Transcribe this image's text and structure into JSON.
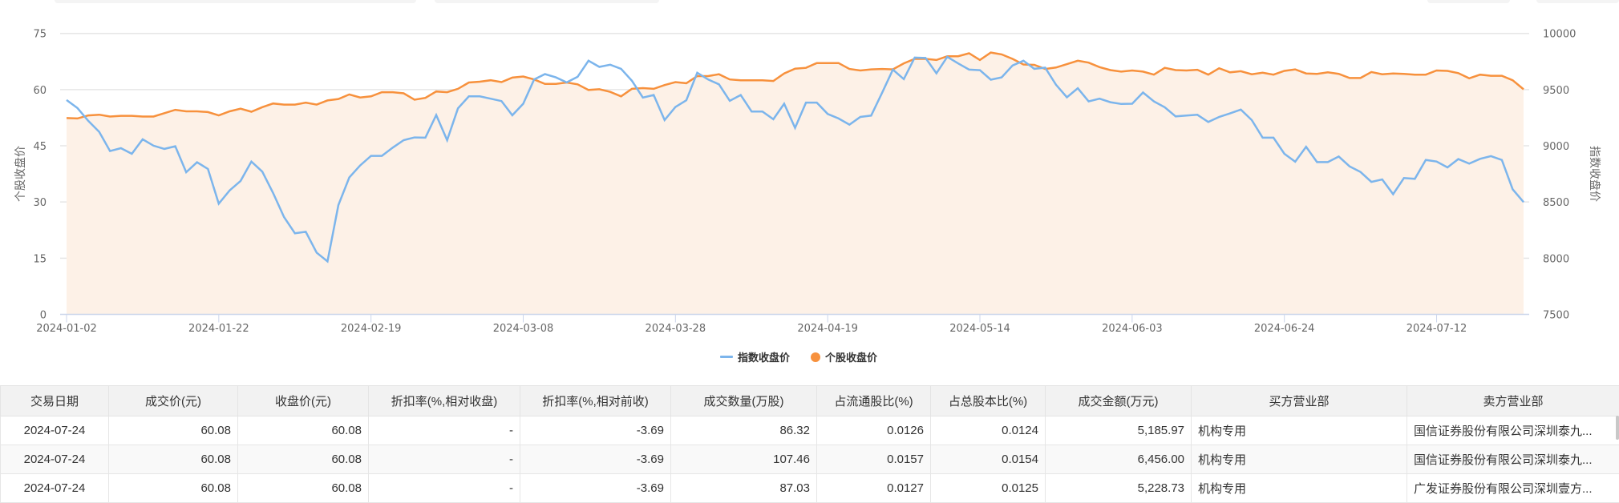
{
  "colors": {
    "index": "#7cb5ec",
    "stock": "#f7913d",
    "fill": "#fdf1e7",
    "grid": "#e6e6e6",
    "axis": "#ccd6eb"
  },
  "chart_data": {
    "type": "line",
    "title": "",
    "left_axis": {
      "label": "个股收盘价",
      "ylim": [
        0,
        75
      ],
      "ticks": [
        "0",
        "15",
        "30",
        "45",
        "60",
        "75"
      ]
    },
    "right_axis": {
      "label": "指数收盘价",
      "ylim": [
        7500,
        10000
      ],
      "ticks": [
        "7500",
        "8000",
        "8500",
        "9000",
        "9500",
        "10000"
      ]
    },
    "x_tick_labels": [
      {
        "index": 0,
        "label": "2024-01-02"
      },
      {
        "index": 14,
        "label": "2024-01-22"
      },
      {
        "index": 28,
        "label": "2024-02-19"
      },
      {
        "index": 42,
        "label": "2024-03-08"
      },
      {
        "index": 56,
        "label": "2024-03-28"
      },
      {
        "index": 70,
        "label": "2024-04-19"
      },
      {
        "index": 84,
        "label": "2024-05-14"
      },
      {
        "index": 98,
        "label": "2024-06-03"
      },
      {
        "index": 112,
        "label": "2024-06-24"
      },
      {
        "index": 126,
        "label": "2024-07-12"
      }
    ],
    "point_count": 135,
    "grid": true,
    "legend_position": "bottom-center",
    "series": [
      {
        "name": "指数收盘价",
        "axis": "right",
        "type": "line",
        "values": [
          9407,
          9336,
          9222,
          9124,
          8953,
          8979,
          8929,
          9058,
          9001,
          8972,
          8996,
          8765,
          8853,
          8794,
          8485,
          8603,
          8687,
          8860,
          8770,
          8580,
          8366,
          8221,
          8235,
          8049,
          7971,
          8473,
          8718,
          8825,
          8910,
          8910,
          8984,
          9050,
          9074,
          9072,
          9274,
          9050,
          9333,
          9440,
          9440,
          9419,
          9398,
          9272,
          9374,
          9590,
          9638,
          9609,
          9564,
          9614,
          9757,
          9702,
          9721,
          9685,
          9578,
          9429,
          9452,
          9229,
          9345,
          9405,
          9650,
          9590,
          9547,
          9400,
          9452,
          9305,
          9305,
          9236,
          9374,
          9160,
          9384,
          9384,
          9283,
          9243,
          9188,
          9257,
          9269,
          9471,
          9678,
          9593,
          9785,
          9781,
          9645,
          9792,
          9733,
          9678,
          9673,
          9588,
          9609,
          9714,
          9757,
          9685,
          9695,
          9543,
          9431,
          9512,
          9395,
          9419,
          9388,
          9372,
          9374,
          9474,
          9395,
          9343,
          9262,
          9269,
          9276,
          9212,
          9257,
          9288,
          9322,
          9229,
          9072,
          9072,
          8929,
          8858,
          8991,
          8855,
          8855,
          8905,
          8817,
          8767,
          8679,
          8701,
          8570,
          8713,
          8706,
          8874,
          8860,
          8808,
          8882,
          8841,
          8884,
          8908,
          8874,
          8613,
          8499
        ]
      },
      {
        "name": "个股收盘价",
        "axis": "left",
        "type": "area",
        "values": [
          52.4,
          52.3,
          53.1,
          53.3,
          52.8,
          53.0,
          53.0,
          52.8,
          52.8,
          53.7,
          54.6,
          54.2,
          54.2,
          54.0,
          53.1,
          54.2,
          54.9,
          54.1,
          55.3,
          56.3,
          56.0,
          56.0,
          56.5,
          56.0,
          57.1,
          57.5,
          58.7,
          57.9,
          58.2,
          59.3,
          59.3,
          59.0,
          57.3,
          57.8,
          59.5,
          59.3,
          60.2,
          61.9,
          62.1,
          62.5,
          62.0,
          63.2,
          63.5,
          62.7,
          61.5,
          61.5,
          61.9,
          61.4,
          59.9,
          60.1,
          59.4,
          58.2,
          60.2,
          60.4,
          60.2,
          61.2,
          62.0,
          61.7,
          63.6,
          63.6,
          64.1,
          62.7,
          62.5,
          62.5,
          62.5,
          62.3,
          64.3,
          65.6,
          65.8,
          67.1,
          67.1,
          67.1,
          65.5,
          65.1,
          65.4,
          65.5,
          65.4,
          67.0,
          68.2,
          68.2,
          67.9,
          68.9,
          68.9,
          69.7,
          67.9,
          69.9,
          69.4,
          68.2,
          66.7,
          66.6,
          65.5,
          65.9,
          66.8,
          67.7,
          67.2,
          66.0,
          65.2,
          64.8,
          65.1,
          64.8,
          64.0,
          65.8,
          65.2,
          65.1,
          65.3,
          64.0,
          65.7,
          64.6,
          64.9,
          64.1,
          64.5,
          64.0,
          65.0,
          65.4,
          64.3,
          64.2,
          64.6,
          64.2,
          63.1,
          63.1,
          64.7,
          64.1,
          64.3,
          64.2,
          64.0,
          64.0,
          65.1,
          65.0,
          64.4,
          63.0,
          64.0,
          63.7,
          63.7,
          62.5,
          60.08
        ]
      }
    ]
  },
  "legend": {
    "index_label": "指数收盘价",
    "stock_label": "个股收盘价"
  },
  "table": {
    "headers": [
      "交易日期",
      "成交价(元)",
      "收盘价(元)",
      "折扣率(%,相对收盘)",
      "折扣率(%,相对前收)",
      "成交数量(万股)",
      "占流通股比(%)",
      "占总股本比(%)",
      "成交金额(万元)",
      "买方营业部",
      "卖方营业部"
    ],
    "rows": [
      [
        "2024-07-24",
        "60.08",
        "60.08",
        "-",
        "-3.69",
        "86.32",
        "0.0126",
        "0.0124",
        "5,185.97",
        "机构专用",
        "国信证券股份有限公司深圳泰九..."
      ],
      [
        "2024-07-24",
        "60.08",
        "60.08",
        "-",
        "-3.69",
        "107.46",
        "0.0157",
        "0.0154",
        "6,456.00",
        "机构专用",
        "国信证券股份有限公司深圳泰九..."
      ],
      [
        "2024-07-24",
        "60.08",
        "60.08",
        "-",
        "-3.69",
        "87.03",
        "0.0127",
        "0.0125",
        "5,228.73",
        "机构专用",
        "广发证券股份有限公司深圳壹方..."
      ]
    ]
  }
}
